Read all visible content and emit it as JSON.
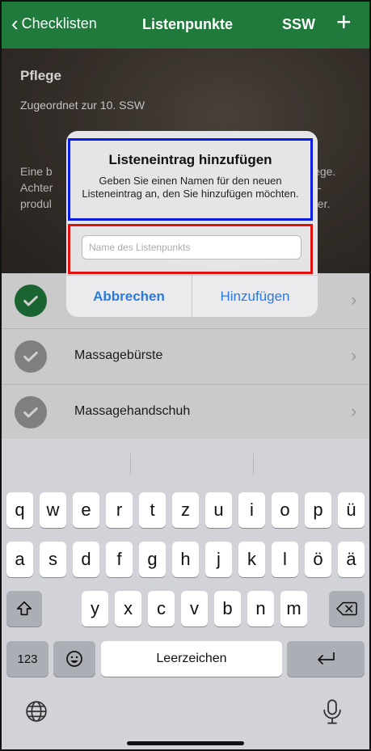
{
  "navbar": {
    "back_label": "Checklisten",
    "title": "Listenpunkte",
    "right_label": "SSW",
    "add_label": "+"
  },
  "header": {
    "title": "Pflege",
    "subtitle": "Zugeordnet zur 10. SSW",
    "description_left": "Eine b\nAchter\nprodul",
    "description_right": "lege.\ne-\nper."
  },
  "list": {
    "items": [
      {
        "label": "",
        "checked": true
      },
      {
        "label": "Massagebürste",
        "checked": false
      },
      {
        "label": "Massagehandschuh",
        "checked": false
      }
    ]
  },
  "dialog": {
    "title": "Listeneintrag hinzufügen",
    "message": "Geben Sie einen Namen für den neuen Listeneintrag an, den Sie hinzufügen möchten.",
    "input_placeholder": "Name des Listenpunkts",
    "input_value": "",
    "cancel_label": "Abbrechen",
    "confirm_label": "Hinzufügen"
  },
  "keyboard": {
    "row1": [
      "q",
      "w",
      "e",
      "r",
      "t",
      "z",
      "u",
      "i",
      "o",
      "p",
      "ü"
    ],
    "row2": [
      "a",
      "s",
      "d",
      "f",
      "g",
      "h",
      "j",
      "k",
      "l",
      "ö",
      "ä"
    ],
    "row3": [
      "y",
      "x",
      "c",
      "v",
      "b",
      "n",
      "m"
    ],
    "numbers_label": "123",
    "space_label": "Leerzeichen"
  },
  "colors": {
    "nav_green": "#1f7a3c",
    "check_green": "#1f7a3c",
    "check_gray": "#9b9b9b",
    "link_blue": "#2a7ae2",
    "highlight_blue": "#0a1ee0",
    "highlight_red": "#e0120f"
  }
}
